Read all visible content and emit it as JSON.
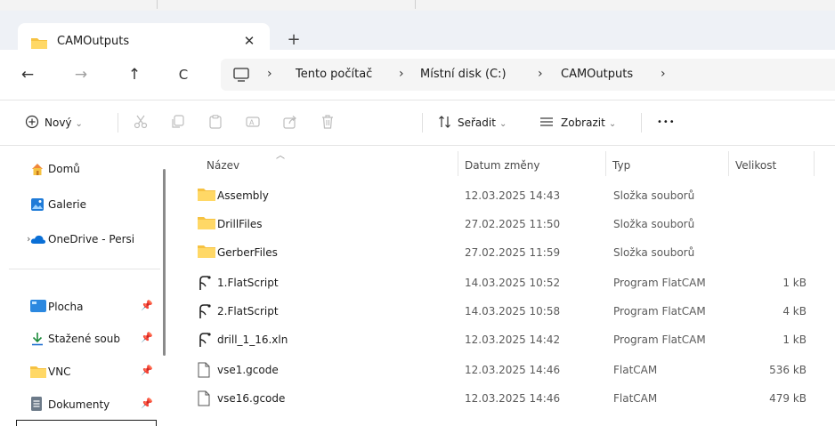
{
  "window": {
    "tab_title": "CAMOutputs",
    "close_glyph": "✕",
    "new_tab_glyph": "+"
  },
  "nav": {
    "back": "←",
    "forward": "→",
    "up": "↑",
    "refresh": "C"
  },
  "breadcrumb": {
    "separator": "›",
    "segments": [
      "Tento počítač",
      "Místní disk (C:)",
      "CAMOutputs"
    ]
  },
  "toolbar": {
    "new_label": "Nový",
    "sort_label": "Seřadit",
    "view_label": "Zobrazit",
    "more_label": "•••"
  },
  "sidebar": {
    "items": [
      {
        "label": "Domů",
        "icon": "home-icon"
      },
      {
        "label": "Galerie",
        "icon": "gallery-icon"
      },
      {
        "label": "OneDrive - Persi",
        "icon": "onedrive-icon"
      },
      {
        "label": "Plocha",
        "icon": "desktop-icon"
      },
      {
        "label": "Stažené soub",
        "icon": "download-icon"
      },
      {
        "label": "VNC",
        "icon": "folder-icon"
      },
      {
        "label": "Dokumenty",
        "icon": "documents-icon"
      }
    ]
  },
  "table": {
    "headers": {
      "name": "Název",
      "date": "Datum změny",
      "type": "Typ",
      "size": "Velikost"
    },
    "rows": [
      {
        "name": "Assembly",
        "date": "12.03.2025 14:43",
        "type": "Složka souborů",
        "size": "",
        "icon": "folder-icon"
      },
      {
        "name": "DrillFiles",
        "date": "27.02.2025 11:50",
        "type": "Složka souborů",
        "size": "",
        "icon": "folder-icon"
      },
      {
        "name": "GerberFiles",
        "date": "27.02.2025 11:59",
        "type": "Složka souborů",
        "size": "",
        "icon": "folder-icon"
      },
      {
        "name": "1.FlatScript",
        "date": "14.03.2025 10:52",
        "type": "Program FlatCAM",
        "size": "1 kB",
        "icon": "script-icon"
      },
      {
        "name": "2.FlatScript",
        "date": "14.03.2025 10:58",
        "type": "Program FlatCAM",
        "size": "4 kB",
        "icon": "script-icon"
      },
      {
        "name": "drill_1_16.xln",
        "date": "12.03.2025 14:42",
        "type": "Program FlatCAM",
        "size": "1 kB",
        "icon": "script-icon"
      },
      {
        "name": "vse1.gcode",
        "date": "12.03.2025 14:46",
        "type": "FlatCAM",
        "size": "536 kB",
        "icon": "file-icon"
      },
      {
        "name": "vse16.gcode",
        "date": "12.03.2025 14:46",
        "type": "FlatCAM",
        "size": "479 kB",
        "icon": "file-icon"
      }
    ]
  },
  "colors": {
    "folder": "#f6c242",
    "accent": "#0067c0",
    "onedrive": "#0a6fd6"
  }
}
